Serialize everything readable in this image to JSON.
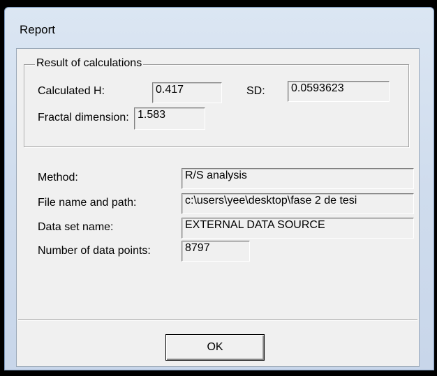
{
  "window": {
    "title": "Report"
  },
  "results_group": {
    "legend": "Result of calculations",
    "calculated_h_label": "Calculated H:",
    "calculated_h_value": "0.417",
    "sd_label": "SD:",
    "sd_value": "0.0593623",
    "fractal_dimension_label": "Fractal dimension:",
    "fractal_dimension_value": "1.583"
  },
  "details": {
    "method_label": "Method:",
    "method_value": "R/S analysis",
    "file_label": "File name and path:",
    "file_value": "c:\\users\\yee\\desktop\\fase 2 de tesi",
    "dataset_label": "Data set name:",
    "dataset_value": "EXTERNAL DATA SOURCE",
    "points_label": "Number of data points:",
    "points_value": "8797"
  },
  "buttons": {
    "ok_label": "OK"
  }
}
